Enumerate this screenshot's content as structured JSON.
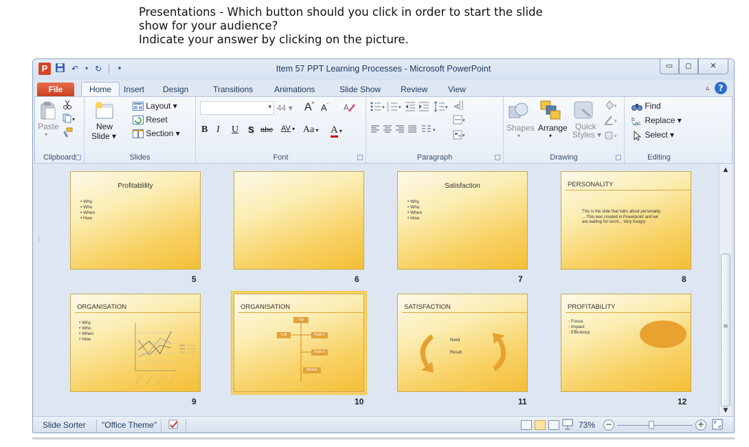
{
  "question": {
    "line1": "Presentations - Which button should you click in order to start the slide",
    "line2": "show for your audience?",
    "line3": "Indicate your answer by clicking on the picture."
  },
  "window": {
    "title": "Item 57 PPT Learning Processes - Microsoft PowerPoint",
    "logo": "P"
  },
  "tabs": [
    "File",
    "Home",
    "Insert",
    "Design",
    "Transitions",
    "Animations",
    "Slide Show",
    "Review",
    "View"
  ],
  "ribbon": {
    "clipboard": {
      "paste": "Paste",
      "label": "Clipboard"
    },
    "slides": {
      "new_slide_1": "New",
      "new_slide_2": "Slide ▾",
      "layout": "Layout ▾",
      "reset": "Reset",
      "section": "Section ▾",
      "label": "Slides"
    },
    "font": {
      "size": "44",
      "grow": "A",
      "shrink": "A",
      "bold": "B",
      "italic": "I",
      "underline": "U",
      "shadow": "S",
      "strike": "abe",
      "spacing": "AV",
      "case": "Aa",
      "color": "A",
      "label": "Font"
    },
    "paragraph": {
      "label": "Paragraph"
    },
    "drawing": {
      "shapes": "Shapes",
      "arrange": "Arrange",
      "quick_styles_1": "Quick",
      "quick_styles_2": "Styles ▾",
      "label": "Drawing"
    },
    "editing": {
      "find": "Find",
      "replace": "Replace ▾",
      "select": "Select ▾",
      "label": "Editing"
    }
  },
  "slides": [
    {
      "num": "5",
      "title": "Profitablility",
      "bullets": [
        "Why",
        "Who",
        "When",
        "How"
      ]
    },
    {
      "num": "6",
      "title": "",
      "bullets": []
    },
    {
      "num": "7",
      "title": "Satisfaction",
      "bullets": [
        "Why",
        "Who",
        "When",
        "How"
      ]
    },
    {
      "num": "8",
      "title": "PERSONALITY",
      "body": "This is the slide that talks about personality ... This was created in Powerpoint and we are waiting for lunch... Very hungry"
    },
    {
      "num": "9",
      "title": "ORGANISATION",
      "bullets": [
        "Why",
        "Who",
        "When",
        "How"
      ]
    },
    {
      "num": "10",
      "title": "ORGANISATION",
      "org": {
        "top": "Top",
        "left": "Left",
        "right1": "Right 1",
        "right2": "Right 2",
        "bottom": "Bottom"
      }
    },
    {
      "num": "11",
      "title": "SATISFACTION",
      "cycle": [
        "Need",
        "Result"
      ]
    },
    {
      "num": "12",
      "title": "PROFITABILITY",
      "bullets": [
        "Focus",
        "Impact",
        "Efficiency"
      ]
    }
  ],
  "statusbar": {
    "view": "Slide Sorter",
    "theme": "\"Office Theme\"",
    "zoom": "73%",
    "zoom_level": 0.45
  }
}
